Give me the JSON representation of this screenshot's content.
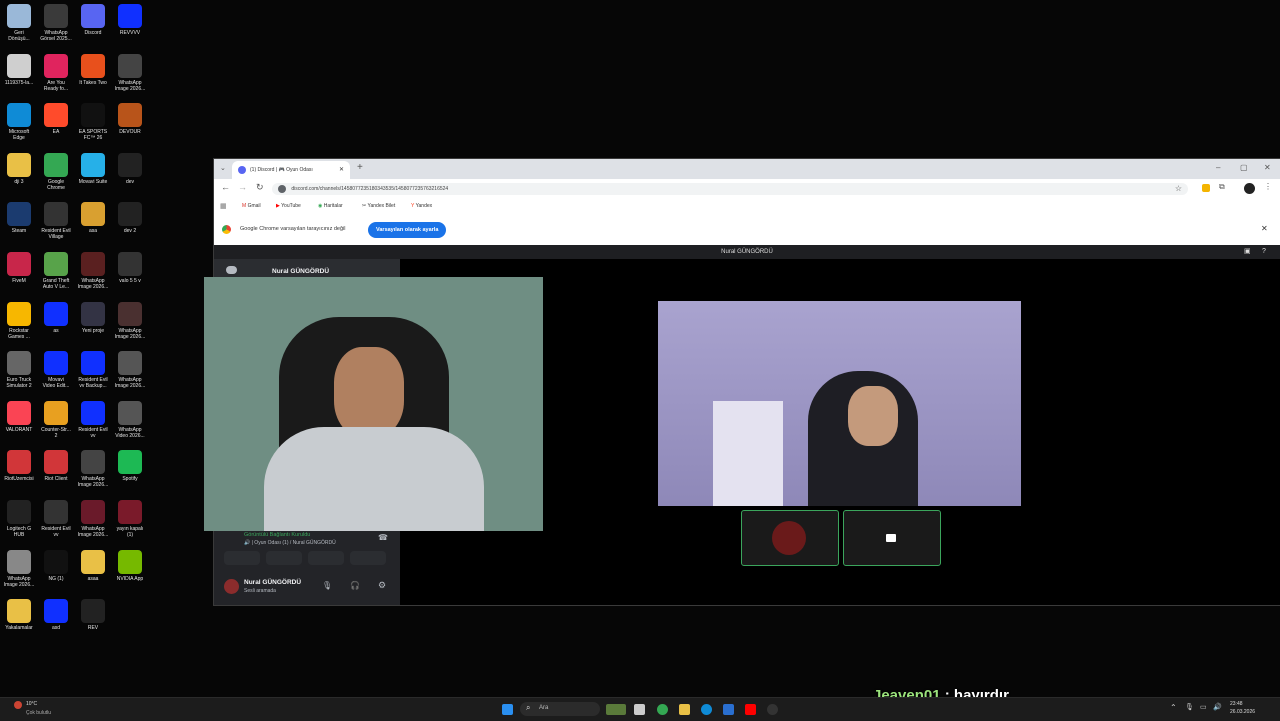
{
  "desktop": {
    "icons": [
      {
        "label": "Geri\nDönüşü...",
        "color": "#9ab8d8"
      },
      {
        "label": "WhatsApp\nGörsel 2025...",
        "color": "#3a3a3a"
      },
      {
        "label": "Discord",
        "color": "#5865f2"
      },
      {
        "label": "REVVVV",
        "color": "#1030ff"
      },
      {
        "label": "1119375-la...",
        "color": "#cfcfcf"
      },
      {
        "label": "Are You\nReady fo...",
        "color": "#e0245e"
      },
      {
        "label": "It Takes Two",
        "color": "#e8501c"
      },
      {
        "label": "WhatsApp\nImage 2026...",
        "color": "#444"
      },
      {
        "label": "Microsoft\nEdge",
        "color": "#0f8bd6"
      },
      {
        "label": "EA",
        "color": "#ff4b2b"
      },
      {
        "label": "EA SPORTS\nFC™ 26",
        "color": "#111"
      },
      {
        "label": "DEVOUR",
        "color": "#b8541a"
      },
      {
        "label": "dji 3",
        "color": "#e9c046"
      },
      {
        "label": "Google\nChrome",
        "color": "#34a853"
      },
      {
        "label": "Movavi Suite",
        "color": "#26b0e8"
      },
      {
        "label": "dev",
        "color": "#222"
      },
      {
        "label": "Steam",
        "color": "#1b3b6f"
      },
      {
        "label": "Resident Evil\nVillage",
        "color": "#333"
      },
      {
        "label": "asa",
        "color": "#d9a030"
      },
      {
        "label": "dev 2",
        "color": "#222"
      },
      {
        "label": "FiveM",
        "color": "#c8264a"
      },
      {
        "label": "Grand Theft\nAuto V Le...",
        "color": "#58a34a"
      },
      {
        "label": "WhatsApp\nImage 2026...",
        "color": "#5a2020"
      },
      {
        "label": "valo 5 5 v",
        "color": "#333"
      },
      {
        "label": "Rockstar\nGames ...",
        "color": "#f7b700"
      },
      {
        "label": "as",
        "color": "#1030ff"
      },
      {
        "label": "Yeni proje",
        "color": "#334"
      },
      {
        "label": "WhatsApp\nImage 2026...",
        "color": "#4a3030"
      },
      {
        "label": "Euro Truck\nSimulator 2",
        "color": "#666"
      },
      {
        "label": "Movavi\nVideo Edit...",
        "color": "#1030ff"
      },
      {
        "label": "Resident Evil\nvv Backup...",
        "color": "#1030ff"
      },
      {
        "label": "WhatsApp\nImage 2026...",
        "color": "#555"
      },
      {
        "label": "VALORANT",
        "color": "#fa4454"
      },
      {
        "label": "Counter-Str...\n2",
        "color": "#e8a020"
      },
      {
        "label": "Resident Evil\nvv",
        "color": "#1030ff"
      },
      {
        "label": "WhatsApp\nVideo 2026...",
        "color": "#555"
      },
      {
        "label": "RiotUzemcisi",
        "color": "#d13639"
      },
      {
        "label": "Riot Client",
        "color": "#d13639"
      },
      {
        "label": "WhatsApp\nImage 2026...",
        "color": "#444"
      },
      {
        "label": "Spotify",
        "color": "#1db954"
      },
      {
        "label": "Logitech G\nHUB",
        "color": "#222"
      },
      {
        "label": "Resident Evil\nvv",
        "color": "#333"
      },
      {
        "label": "WhatsApp\nImage 2026...",
        "color": "#6a1a2a"
      },
      {
        "label": "yayın kapalı\n(1)",
        "color": "#7a1a2a"
      },
      {
        "label": "WhatsApp\nImage 2026...",
        "color": "#888"
      },
      {
        "label": "NG (1)",
        "color": "#111"
      },
      {
        "label": "asaa",
        "color": "#e9c046"
      },
      {
        "label": "NVIDIA App",
        "color": "#76b900"
      },
      {
        "label": "Yakalamalar",
        "color": "#e9c046"
      },
      {
        "label": "asd",
        "color": "#1030ff"
      },
      {
        "label": "REV",
        "color": "#222"
      }
    ]
  },
  "browser": {
    "tab_title": "(1) Discord | 🎮 Oyun Odası",
    "new_tab": "+",
    "url": "discord.com/channels/1458077235180343535/1458077235763216524",
    "bookmarks": [
      "Gmail",
      "YouTube",
      "Haritalar",
      "Yandex Bilet",
      "Yandex"
    ],
    "infobar_text": "Google Chrome varsayılan tarayıcınız değil",
    "infobar_button": "Varsayılan olarak ayarla",
    "close_glyph": "✕"
  },
  "discord": {
    "call_title": "Nural GÜNGÖRDÜ",
    "server_name": "Nural GÜNGÖRDÜ",
    "voice_status": "Görüntülü Bağlantı Kuruldu",
    "voice_channel": "🔊 | Oyun Odası (1) / Nural GÜNGÖRDÜ",
    "user_name": "Nural GÜNGÖRDÜ",
    "user_status": "Sesli aramada"
  },
  "overlay": {
    "chat_user": "Jeaven01",
    "chat_sep": " : ",
    "chat_text": "hayırdır"
  },
  "taskbar": {
    "weather_temp": "10°C",
    "weather_desc": "Çok bulutlu",
    "search_placeholder": "Ara",
    "time": "23:48",
    "date": "26.03.2026"
  },
  "colors": {
    "accent": "#5865f2",
    "online": "#3ba55c",
    "chrome_blue": "#1a73e8"
  }
}
